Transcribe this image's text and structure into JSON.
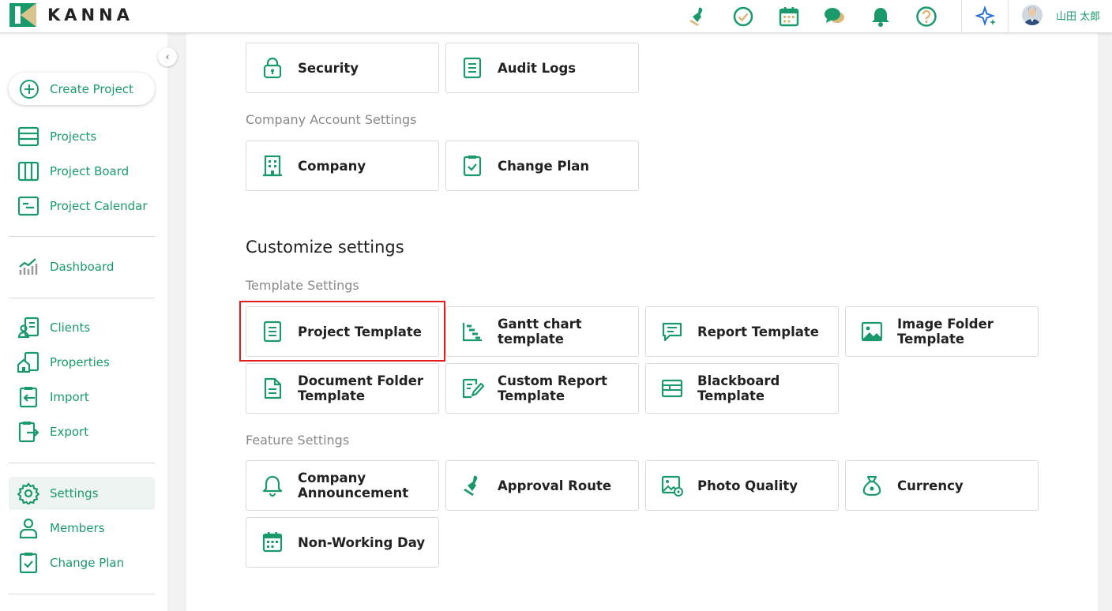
{
  "brand": {
    "name": "KANNA"
  },
  "header": {
    "icons": [
      "stamp-icon",
      "check-circle-icon",
      "calendar-icon",
      "chat-icon",
      "bell-icon",
      "help-icon",
      "sparkle-icon"
    ],
    "user_name": "山田 太郎"
  },
  "sidebar": {
    "create_label": "Create Project",
    "items": [
      {
        "label": "Projects",
        "icon": "list-icon"
      },
      {
        "label": "Project Board",
        "icon": "board-icon"
      },
      {
        "label": "Project Calendar",
        "icon": "calendar-list-icon"
      },
      {
        "label": "Dashboard",
        "icon": "chart-icon"
      },
      {
        "label": "Clients",
        "icon": "clients-icon"
      },
      {
        "label": "Properties",
        "icon": "house-icon"
      },
      {
        "label": "Import",
        "icon": "import-icon"
      },
      {
        "label": "Export",
        "icon": "export-icon"
      },
      {
        "label": "Settings",
        "icon": "gear-icon"
      },
      {
        "label": "Members",
        "icon": "person-icon"
      },
      {
        "label": "Change Plan",
        "icon": "clipboard-check-icon"
      }
    ],
    "active": "Settings"
  },
  "main": {
    "top_cards": [
      {
        "label": "Security",
        "icon": "lock-icon"
      },
      {
        "label": "Audit Logs",
        "icon": "document-icon"
      }
    ],
    "company_account_label": "Company Account Settings",
    "company_cards": [
      {
        "label": "Company",
        "icon": "building-icon"
      },
      {
        "label": "Change Plan",
        "icon": "clipboard-check-icon"
      }
    ],
    "customize_title": "Customize settings",
    "template_label": "Template Settings",
    "template_cards": [
      {
        "label": "Project Template",
        "icon": "document-icon"
      },
      {
        "label": "Gantt chart template",
        "icon": "gantt-icon"
      },
      {
        "label": "Report Template",
        "icon": "report-icon"
      },
      {
        "label": "Image Folder Template",
        "icon": "image-icon"
      },
      {
        "label": "Document Folder Template",
        "icon": "file-icon"
      },
      {
        "label": "Custom Report Template",
        "icon": "edit-report-icon"
      },
      {
        "label": "Blackboard Template",
        "icon": "blackboard-icon"
      }
    ],
    "feature_label": "Feature Settings",
    "feature_cards": [
      {
        "label": "Company Announcement",
        "icon": "bell-icon"
      },
      {
        "label": "Approval Route",
        "icon": "stamp-icon"
      },
      {
        "label": "Photo Quality",
        "icon": "photo-settings-icon"
      },
      {
        "label": "Currency",
        "icon": "money-bag-icon"
      },
      {
        "label": "Non-Working Day",
        "icon": "calendar-icon"
      }
    ]
  },
  "colors": {
    "accent": "#1a9a6a",
    "highlight": "#e21b1b",
    "gold": "#d9b87a"
  }
}
